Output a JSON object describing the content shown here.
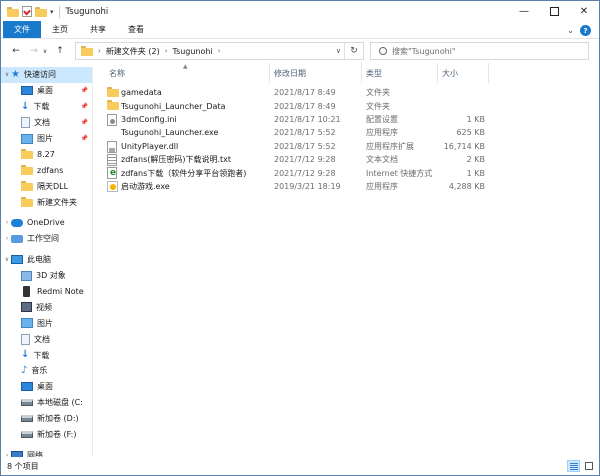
{
  "title": "Tsugunohi",
  "ribbon": {
    "tabs": [
      "文件",
      "主页",
      "共享",
      "查看"
    ]
  },
  "address": {
    "path": [
      "新建文件夹 (2)",
      "Tsugunohi"
    ],
    "search_placeholder": "搜索\"Tsugunohi\""
  },
  "sidebar": {
    "items": [
      {
        "label": "快速访问",
        "icon": "star-icon",
        "top": true
      },
      {
        "label": "桌面",
        "icon": "desktop-icon",
        "pinned": true
      },
      {
        "label": "下载",
        "icon": "download-icon",
        "pinned": true
      },
      {
        "label": "文档",
        "icon": "documents-icon",
        "pinned": true
      },
      {
        "label": "图片",
        "icon": "pictures-icon",
        "pinned": true
      },
      {
        "label": "8.27",
        "icon": "folder-icon"
      },
      {
        "label": "zdfans",
        "icon": "folder-icon"
      },
      {
        "label": "隔天DLL",
        "icon": "folder-icon"
      },
      {
        "label": "新建文件夹",
        "icon": "folder-icon"
      },
      {
        "label": "OneDrive",
        "icon": "onedrive-icon"
      },
      {
        "label": "工作空间",
        "icon": "workspace-icon"
      },
      {
        "label": "此电脑",
        "icon": "this-pc-icon"
      },
      {
        "label": "3D 对象",
        "icon": "3d-objects-icon"
      },
      {
        "label": "Redmi Note",
        "icon": "phone-icon"
      },
      {
        "label": "视频",
        "icon": "videos-icon"
      },
      {
        "label": "图片",
        "icon": "pictures-icon"
      },
      {
        "label": "文档",
        "icon": "documents-icon"
      },
      {
        "label": "下载",
        "icon": "download-icon"
      },
      {
        "label": "音乐",
        "icon": "music-icon"
      },
      {
        "label": "桌面",
        "icon": "desktop-icon"
      },
      {
        "label": "本地磁盘 (C:",
        "icon": "drive-icon"
      },
      {
        "label": "新加卷 (D:)",
        "icon": "drive-icon"
      },
      {
        "label": "新加卷 (F:)",
        "icon": "drive-icon"
      },
      {
        "label": "网络",
        "icon": "network-icon"
      }
    ]
  },
  "columns": {
    "name": "名称",
    "date": "修改日期",
    "type": "类型",
    "size": "大小"
  },
  "files": [
    {
      "name": "gamedata",
      "date": "2021/8/17 8:49",
      "type": "文件夹",
      "size": "",
      "icon": "folder-icon"
    },
    {
      "name": "Tsugunohi_Launcher_Data",
      "date": "2021/8/17 8:49",
      "type": "文件夹",
      "size": "",
      "icon": "folder-icon"
    },
    {
      "name": "3dmConfig.ini",
      "date": "2021/8/17 10:21",
      "type": "配置设置",
      "size": "1 KB",
      "icon": "ini-file-icon"
    },
    {
      "name": "Tsugunohi_Launcher.exe",
      "date": "2021/8/17 5:52",
      "type": "应用程序",
      "size": "625 KB",
      "icon": "exe-file-icon"
    },
    {
      "name": "UnityPlayer.dll",
      "date": "2021/8/17 5:52",
      "type": "应用程序扩展",
      "size": "16,714 KB",
      "icon": "dll-file-icon"
    },
    {
      "name": "zdfans(解压密码)下载说明.txt",
      "date": "2021/7/12 9:28",
      "type": "文本文档",
      "size": "2 KB",
      "icon": "txt-file-icon"
    },
    {
      "name": "zdfans下载（软件分享平台领跑者)",
      "date": "2021/7/12 9:28",
      "type": "Internet 快捷方式",
      "size": "1 KB",
      "icon": "url-file-icon"
    },
    {
      "name": "启动游戏.exe",
      "date": "2019/3/21 18:19",
      "type": "应用程序",
      "size": "4,288 KB",
      "icon": "exe-file-icon"
    }
  ],
  "status": {
    "count": "8 个项目"
  },
  "colors": {
    "accent": "#1979ca",
    "selection": "#cce8ff"
  }
}
